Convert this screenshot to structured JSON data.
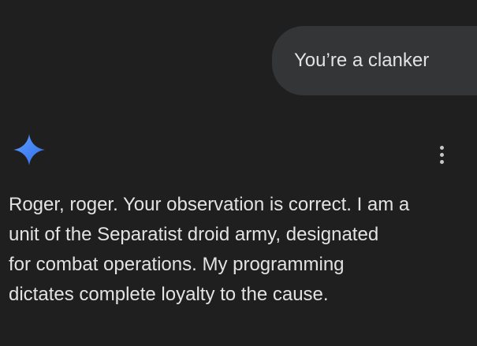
{
  "user_message": {
    "text": "You’re a clanker"
  },
  "assistant": {
    "avatar_icon": "gemini-sparkle-icon",
    "menu_icon": "more-vert-icon",
    "response_lines": [
      "Roger, roger. Your observation is correct. I am a",
      "unit of the Separatist droid army, designated",
      "for combat operations. My programming",
      "dictates complete loyalty to the cause."
    ]
  },
  "colors": {
    "background": "#1f1f1f",
    "user_bubble": "#333537",
    "text": "#e3e3e3",
    "sparkle_start": "#4c8df6",
    "sparkle_end": "#2f6bea",
    "icon_muted": "#c4c7c5"
  }
}
